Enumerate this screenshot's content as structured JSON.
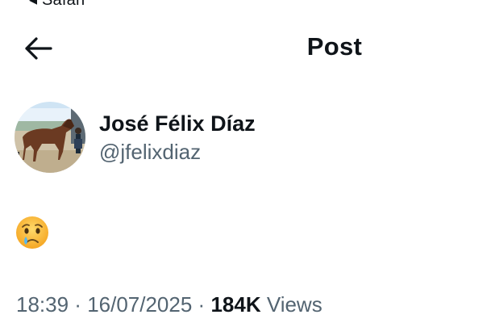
{
  "status_bar": {
    "cutoff_text": "◂ Safari"
  },
  "header": {
    "title": "Post",
    "back_icon": "arrow-left-icon"
  },
  "author": {
    "display_name": "José Félix Díaz",
    "handle": "@jfelixdiaz",
    "avatar_icon": "avatar-horse-photo"
  },
  "post": {
    "content_emoji": "crying-face-emoji"
  },
  "meta": {
    "time": "18:39",
    "sep1": " · ",
    "date": "16/07/2025",
    "sep2": " · ",
    "views_count": "184K",
    "views_label": " Views"
  },
  "colors": {
    "text_primary": "#0f1419",
    "text_secondary": "#536471",
    "background": "#ffffff"
  }
}
